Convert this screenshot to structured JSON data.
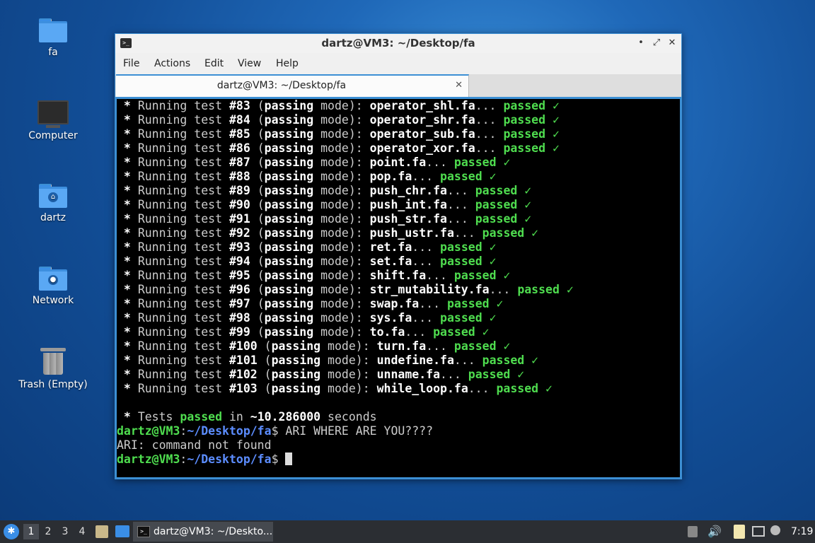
{
  "desktop": {
    "icons": [
      {
        "label": "fa"
      },
      {
        "label": "Computer"
      },
      {
        "label": "dartz"
      },
      {
        "label": "Network"
      },
      {
        "label": "Trash (Empty)"
      }
    ]
  },
  "window": {
    "title": "dartz@VM3: ~/Desktop/fa",
    "menu": [
      "File",
      "Actions",
      "Edit",
      "View",
      "Help"
    ],
    "tab_label": "dartz@VM3: ~/Desktop/fa",
    "controls": {
      "minimize": "•",
      "maximize": "⤢",
      "close": "✕"
    }
  },
  "terminal": {
    "tests": [
      {
        "num": "#83",
        "file": "operator_shl.fa"
      },
      {
        "num": "#84",
        "file": "operator_shr.fa"
      },
      {
        "num": "#85",
        "file": "operator_sub.fa"
      },
      {
        "num": "#86",
        "file": "operator_xor.fa"
      },
      {
        "num": "#87",
        "file": "point.fa"
      },
      {
        "num": "#88",
        "file": "pop.fa"
      },
      {
        "num": "#89",
        "file": "push_chr.fa"
      },
      {
        "num": "#90",
        "file": "push_int.fa"
      },
      {
        "num": "#91",
        "file": "push_str.fa"
      },
      {
        "num": "#92",
        "file": "push_ustr.fa"
      },
      {
        "num": "#93",
        "file": "ret.fa"
      },
      {
        "num": "#94",
        "file": "set.fa"
      },
      {
        "num": "#95",
        "file": "shift.fa"
      },
      {
        "num": "#96",
        "file": "str_mutability.fa"
      },
      {
        "num": "#97",
        "file": "swap.fa"
      },
      {
        "num": "#98",
        "file": "sys.fa"
      },
      {
        "num": "#99",
        "file": "to.fa"
      },
      {
        "num": "#100",
        "file": "turn.fa"
      },
      {
        "num": "#101",
        "file": "undefine.fa"
      },
      {
        "num": "#102",
        "file": "unname.fa"
      },
      {
        "num": "#103",
        "file": "while_loop.fa"
      }
    ],
    "summary": {
      "prefix": " * Tests ",
      "passed": "passed",
      "in": " in ",
      "time": "~10.286000",
      "seconds": " seconds"
    },
    "prompt_user": "dartz@VM3",
    "prompt_path": "~/Desktop/fa",
    "command1": " ARI WHERE ARE YOU????",
    "error_output": "ARI: command not found"
  },
  "taskbar": {
    "workspaces": [
      "1",
      "2",
      "3",
      "4"
    ],
    "active_task": "dartz@VM3: ~/Deskto...",
    "clock": "7:19"
  }
}
